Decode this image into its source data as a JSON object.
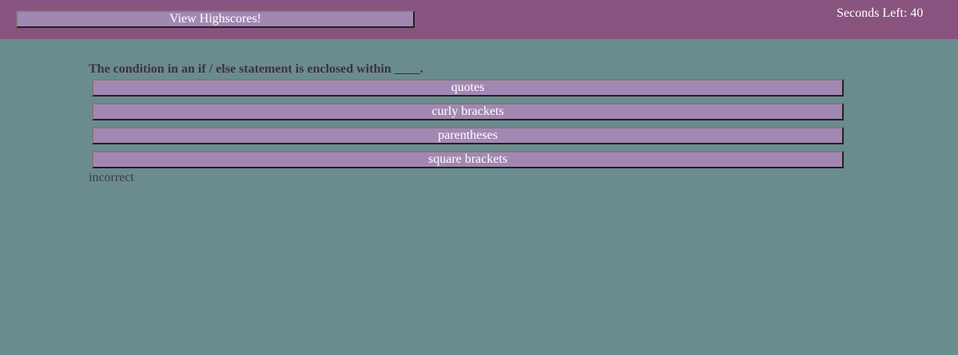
{
  "header": {
    "highscores_label": "View Highscores!",
    "timer_label": "Seconds Left:",
    "timer_value": "40"
  },
  "quiz": {
    "question": "The condition in an if / else statement is enclosed within ____.",
    "answers": [
      {
        "label": "quotes"
      },
      {
        "label": "curly brackets"
      },
      {
        "label": "parentheses"
      },
      {
        "label": "square brackets"
      }
    ],
    "feedback": "incorrect"
  },
  "colors": {
    "header_bg": "#88547f",
    "page_bg": "#6a8c8e",
    "button_bg": "#a387b3",
    "question_text": "#3f2f47"
  }
}
